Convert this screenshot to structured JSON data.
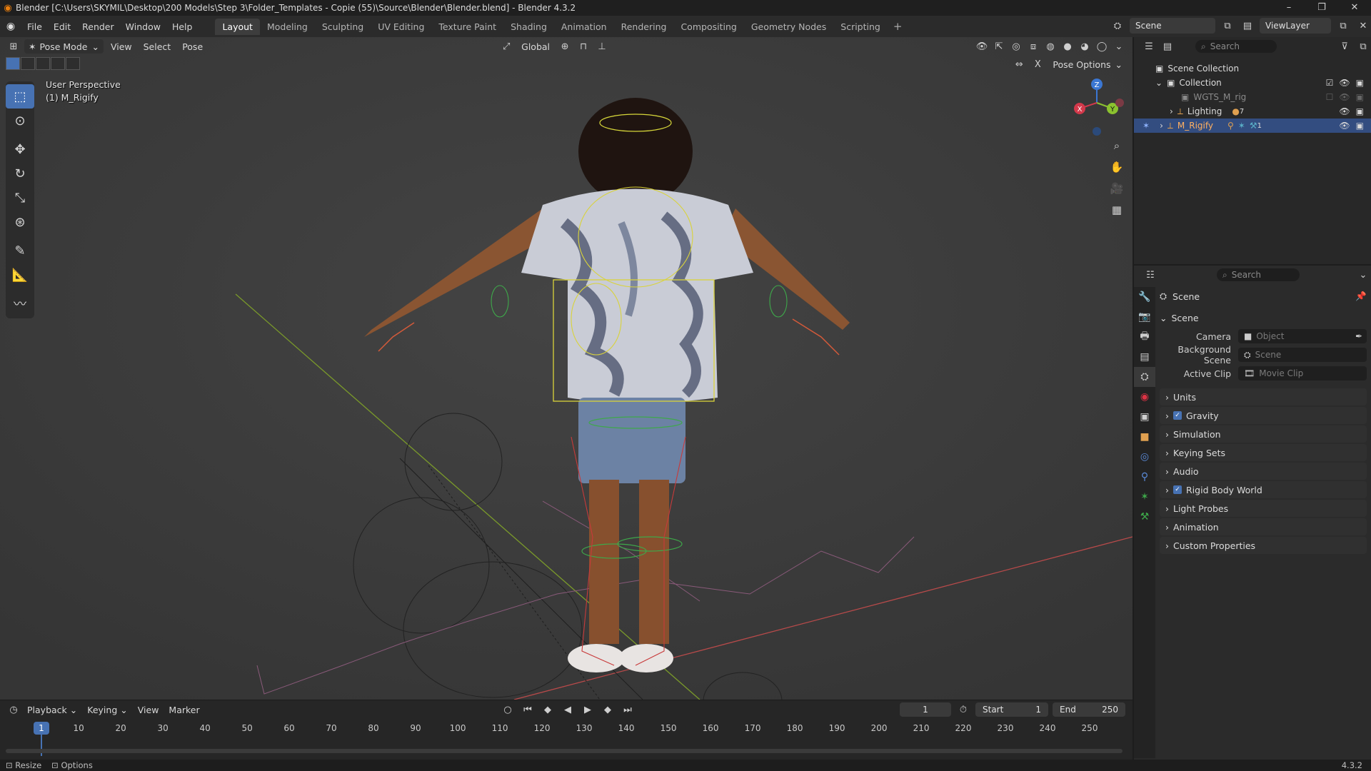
{
  "window": {
    "title": "Blender [C:\\Users\\SKYMIL\\Desktop\\200 Models\\Step 3\\Folder_Templates - Copie (55)\\Source\\Blender\\Blender.blend] - Blender 4.3.2",
    "controls": [
      "–",
      "❐",
      "✕"
    ]
  },
  "menubar": {
    "menus": [
      "File",
      "Edit",
      "Render",
      "Window",
      "Help"
    ],
    "workspaces": [
      "Layout",
      "Modeling",
      "Sculpting",
      "UV Editing",
      "Texture Paint",
      "Shading",
      "Animation",
      "Rendering",
      "Compositing",
      "Geometry Nodes",
      "Scripting"
    ],
    "active_workspace": "Layout",
    "add_workspace": "+",
    "scene": "Scene",
    "view_layer": "ViewLayer"
  },
  "viewport": {
    "mode": "Pose Mode",
    "menus": [
      "View",
      "Select",
      "Pose"
    ],
    "orientation": "Global",
    "pose_options": "Pose Options",
    "overlay_line1": "User Perspective",
    "overlay_line2": "(1) M_Rigify",
    "gizmo_axes": {
      "x": "X",
      "y": "Y",
      "z": "Z"
    },
    "colors": {
      "x": "#d3394b",
      "y": "#8bc22f",
      "z": "#3b77d3"
    }
  },
  "timeline": {
    "menus": [
      "Playback",
      "Keying",
      "View",
      "Marker"
    ],
    "current_frame": "1",
    "start_label": "Start",
    "start_value": "1",
    "end_label": "End",
    "end_value": "250",
    "ticks": [
      "1",
      "10",
      "20",
      "30",
      "40",
      "50",
      "60",
      "70",
      "80",
      "90",
      "100",
      "110",
      "120",
      "130",
      "140",
      "150",
      "160",
      "170",
      "180",
      "190",
      "200",
      "210",
      "220",
      "230",
      "240",
      "250"
    ]
  },
  "statusbar": {
    "left1": "Resize",
    "left2": "Options",
    "version": "4.3.2"
  },
  "outliner": {
    "search_placeholder": "Search",
    "rows": [
      {
        "label": "Scene Collection"
      },
      {
        "label": "Collection"
      },
      {
        "label": "WGTS_M_rig"
      },
      {
        "label": "Lighting",
        "badge": "7"
      },
      {
        "label": "M_Rigify",
        "badge": "1"
      }
    ]
  },
  "properties": {
    "search_placeholder": "Search",
    "context": "Scene",
    "section": "Scene",
    "fields": [
      {
        "label": "Camera",
        "value": "Object"
      },
      {
        "label": "Background Scene",
        "value": "Scene"
      },
      {
        "label": "Active Clip",
        "value": "Movie Clip"
      }
    ],
    "panels": [
      {
        "label": "Units",
        "check": false
      },
      {
        "label": "Gravity",
        "check": true
      },
      {
        "label": "Simulation",
        "check": false
      },
      {
        "label": "Keying Sets",
        "check": false
      },
      {
        "label": "Audio",
        "check": false
      },
      {
        "label": "Rigid Body World",
        "check": true
      },
      {
        "label": "Light Probes",
        "check": false
      },
      {
        "label": "Animation",
        "check": false
      },
      {
        "label": "Custom Properties",
        "check": false
      }
    ]
  }
}
